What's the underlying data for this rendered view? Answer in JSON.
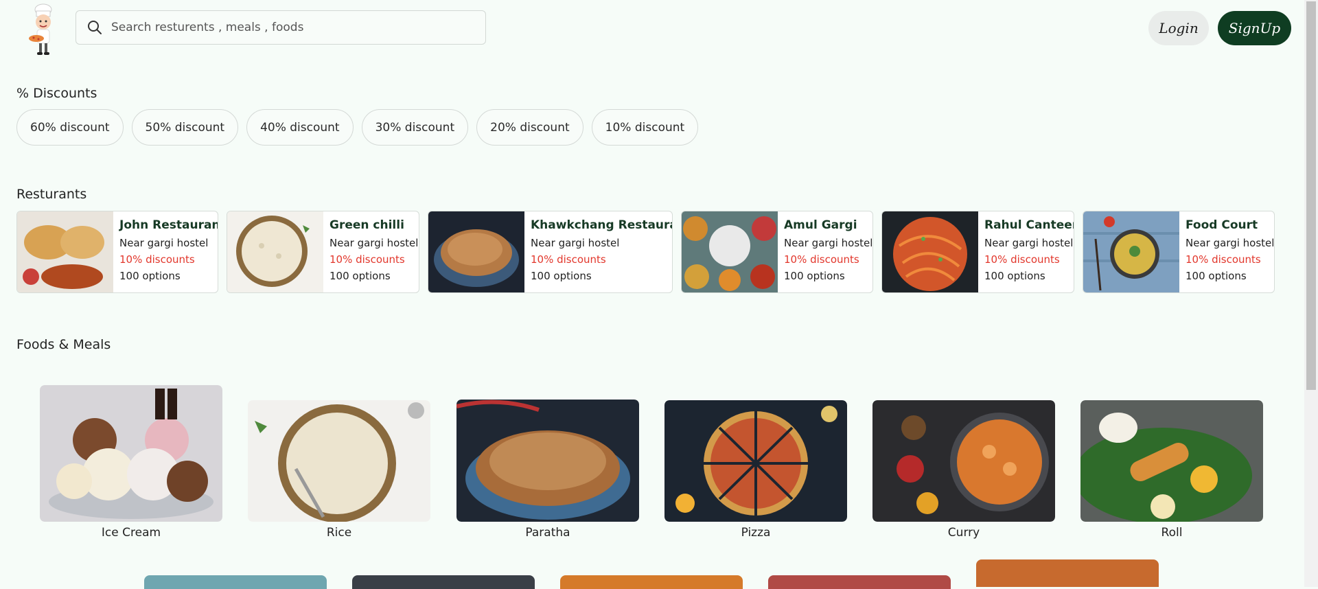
{
  "header": {
    "search_placeholder": "Search resturents , meals , foods",
    "login_label": "Login",
    "signup_label": "SignUp",
    "accent_color": "#0f3d22"
  },
  "discounts": {
    "title": "% Discounts",
    "chips": [
      "60% discount",
      "50% discount",
      "40% discount",
      "30% discount",
      "20% discount",
      "10% discount"
    ]
  },
  "restaurants": {
    "title": "Resturants",
    "items": [
      {
        "name": "John Restaurant",
        "location": "Near gargi hostel",
        "discount": "10% discounts",
        "options": "100 options"
      },
      {
        "name": "Green chilli",
        "location": "Near gargi hostel",
        "discount": "10% discounts",
        "options": "100 options"
      },
      {
        "name": "Khawkchang Restaurant",
        "location": "Near gargi hostel",
        "discount": "10% discounts",
        "options": "100 options"
      },
      {
        "name": "Amul Gargi",
        "location": "Near gargi hostel",
        "discount": "10% discounts",
        "options": "100 options"
      },
      {
        "name": "Rahul Canteen",
        "location": "Near gargi hostel",
        "discount": "10% discounts",
        "options": "100 options"
      },
      {
        "name": "Food Court",
        "location": "Near gargi hostel",
        "discount": "10% discounts",
        "options": "100 options"
      }
    ]
  },
  "foods": {
    "title": "Foods & Meals",
    "items": [
      "Ice Cream",
      "Rice",
      "Paratha",
      "Pizza",
      "Curry",
      "Roll"
    ]
  }
}
